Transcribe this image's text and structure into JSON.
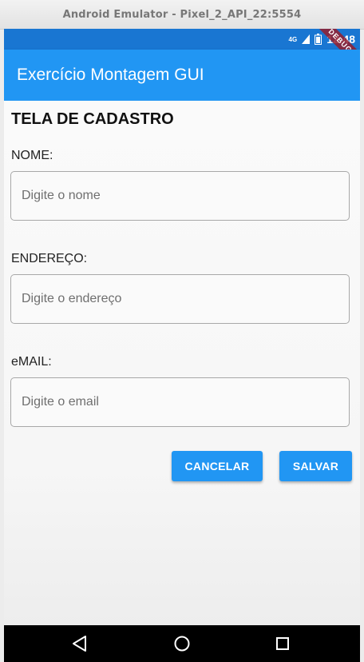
{
  "window": {
    "title": "Android Emulator - Pixel_2_API_22:5554"
  },
  "statusbar": {
    "network": "4G",
    "time": "12:48",
    "debug_banner": "DEBUG"
  },
  "appbar": {
    "title": "Exercício Montagem GUI"
  },
  "form": {
    "heading": "TELA DE CADASTRO",
    "fields": [
      {
        "label": "NOME:",
        "placeholder": "Digite o nome",
        "value": ""
      },
      {
        "label": "ENDEREÇO:",
        "placeholder": "Digite o endereço",
        "value": ""
      },
      {
        "label": "eMAIL:",
        "placeholder": "Digite o email",
        "value": ""
      }
    ],
    "cancel_label": "CANCELAR",
    "save_label": "SALVAR"
  },
  "navbar": {
    "icons": [
      "back-icon",
      "home-icon",
      "recents-icon"
    ]
  },
  "colors": {
    "primary": "#2196f3",
    "primary_dark": "#1976d2",
    "debug_ribbon": "#961e2d"
  }
}
